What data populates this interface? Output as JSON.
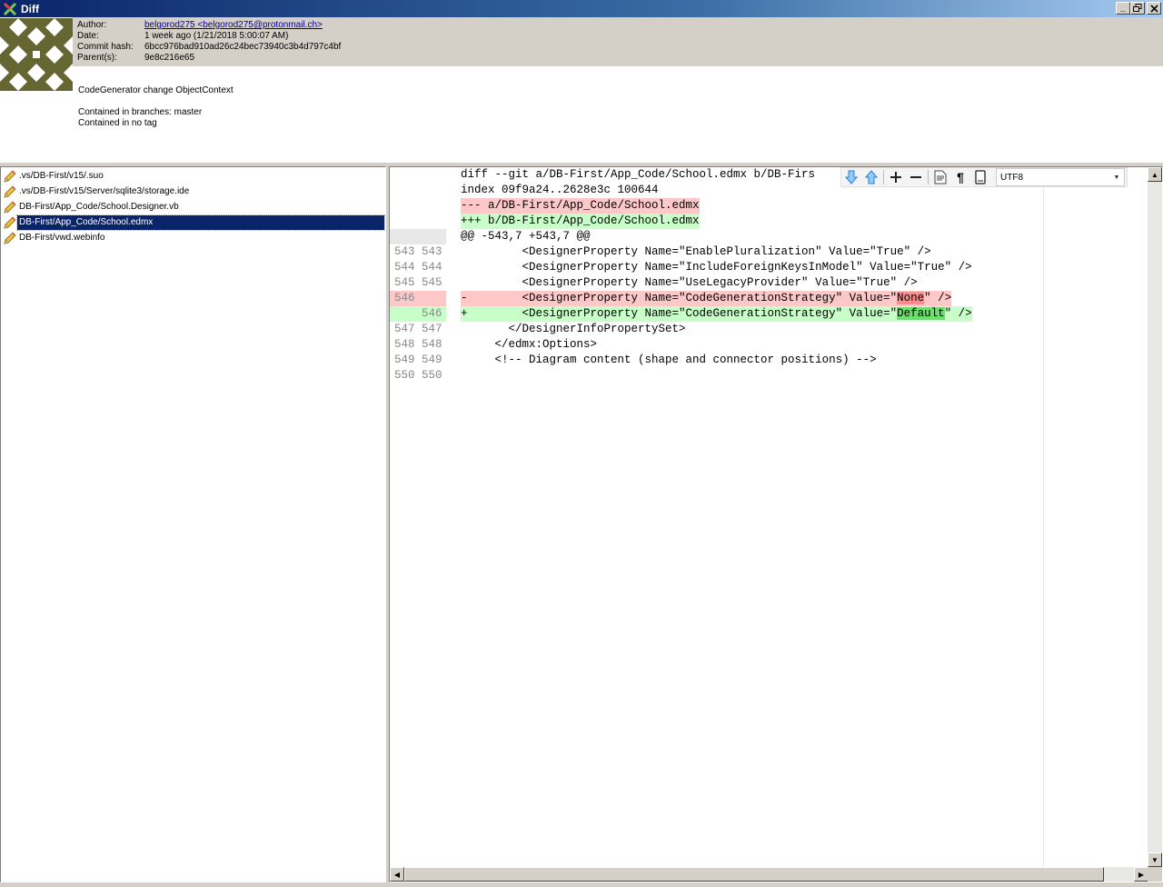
{
  "window": {
    "title": "Diff"
  },
  "commit": {
    "author_label": "Author:",
    "author_value": "belgorod275 <belgorod275@protonmail.ch>",
    "date_label": "Date:",
    "date_value": "1 week ago (1/21/2018 5:00:07 AM)",
    "hash_label": "Commit hash:",
    "hash_value": "6bcc976bad910ad26c24bec73940c3b4d797c4bf",
    "parents_label": "Parent(s):",
    "parents_value": "9e8c216e65",
    "message": "CodeGenerator change ObjectContext",
    "branches": "Contained in branches: master",
    "tags": "Contained in no tag"
  },
  "files": [
    {
      "name": ".vs/DB-First/v15/.suo",
      "selected": false
    },
    {
      "name": ".vs/DB-First/v15/Server/sqlite3/storage.ide",
      "selected": false
    },
    {
      "name": "DB-First/App_Code/School.Designer.vb",
      "selected": false
    },
    {
      "name": "DB-First/App_Code/School.edmx",
      "selected": true
    },
    {
      "name": "DB-First/vwd.webinfo",
      "selected": false
    }
  ],
  "toolbar": {
    "encoding": "UTF8",
    "icons": [
      "next-diff-icon",
      "previous-diff-icon",
      "increase-context-icon",
      "decrease-context-icon",
      "show-entire-file-icon",
      "show-whitespace-icon",
      "copy-icon"
    ]
  },
  "diff": {
    "lines": [
      {
        "old": "",
        "new": "",
        "kind": "meta",
        "text": "diff --git a/DB-First/App_Code/School.edmx b/DB-Firs"
      },
      {
        "old": "",
        "new": "",
        "kind": "meta",
        "text": "index 09f9a24..2628e3c 100644"
      },
      {
        "old": "",
        "new": "",
        "kind": "rem",
        "text": "--- a/DB-First/App_Code/School.edmx"
      },
      {
        "old": "",
        "new": "",
        "kind": "add",
        "text": "+++ b/DB-First/App_Code/School.edmx"
      },
      {
        "old": "",
        "new": "",
        "kind": "hunk",
        "text": "@@ -543,7 +543,7 @@"
      },
      {
        "old": "543",
        "new": "543",
        "kind": "ctx",
        "text": "         <DesignerProperty Name=\"EnablePluralization\" Value=\"True\" />"
      },
      {
        "old": "544",
        "new": "544",
        "kind": "ctx",
        "text": "         <DesignerProperty Name=\"IncludeForeignKeysInModel\" Value=\"True\" />"
      },
      {
        "old": "545",
        "new": "545",
        "kind": "ctx",
        "text": "         <DesignerProperty Name=\"UseLegacyProvider\" Value=\"True\" />"
      },
      {
        "old": "546",
        "new": "",
        "kind": "rem",
        "pre": "-        <DesignerProperty Name=\"CodeGenerationStrategy\" Value=\"",
        "hl": "None",
        "post": "\" />"
      },
      {
        "old": "",
        "new": "546",
        "kind": "add",
        "pre": "+        <DesignerProperty Name=\"CodeGenerationStrategy\" Value=\"",
        "hl": "Default",
        "post": "\" />"
      },
      {
        "old": "547",
        "new": "547",
        "kind": "ctx",
        "text": "       </DesignerInfoPropertySet>"
      },
      {
        "old": "548",
        "new": "548",
        "kind": "ctx",
        "text": "     </edmx:Options>"
      },
      {
        "old": "549",
        "new": "549",
        "kind": "ctx",
        "text": "     <!-- Diagram content (shape and connector positions) -->"
      },
      {
        "old": "550",
        "new": "550",
        "kind": "ctx",
        "text": ""
      }
    ]
  }
}
